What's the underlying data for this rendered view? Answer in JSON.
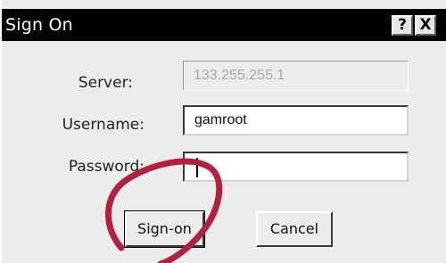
{
  "window": {
    "title": "Sign On",
    "help_label": "?",
    "close_label": "X"
  },
  "form": {
    "server_label": "Server:",
    "server_value": "133.255.255.1",
    "username_label": "Username:",
    "username_value": "gamroot",
    "password_label": "Password:",
    "password_value": ""
  },
  "buttons": {
    "signon_label": "Sign-on",
    "cancel_label": "Cancel"
  },
  "colors": {
    "annotation_circle": "#b0223f",
    "titlebar": "#000000",
    "dialog_bg": "#ececec"
  }
}
